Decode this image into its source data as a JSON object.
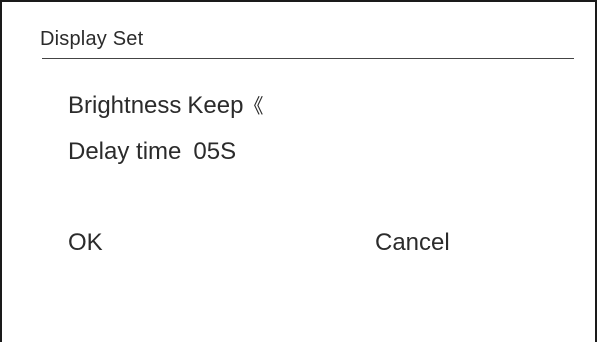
{
  "screen": {
    "title": "Display Set"
  },
  "settings": {
    "brightness": {
      "label": "Brightness",
      "value": "Keep",
      "selector_glyph": "《"
    },
    "delay": {
      "label": "Delay time",
      "value": "05S"
    }
  },
  "buttons": {
    "ok_label": "OK",
    "cancel_label": "Cancel"
  }
}
